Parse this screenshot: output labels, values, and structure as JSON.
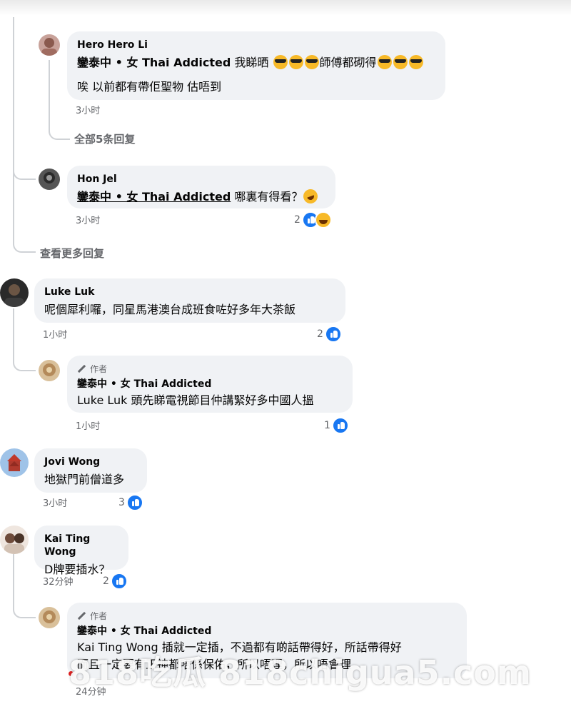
{
  "reply_hero": {
    "author": "Hero Hero Li",
    "tag": "鑾泰中 • 女 Thai Addicted",
    "text_a": "我睇晒",
    "text_b": "師傅都砌得",
    "line2": "唉 以前都有帶佢聖物 估唔到",
    "time": "3小时"
  },
  "view_replies_5": "全部5条回复",
  "reply_hon": {
    "author": "Hon Jel",
    "tag": "鑾泰中 • 女 Thai Addicted",
    "text": "哪裏有得看？",
    "time": "3小时",
    "reactions": "2"
  },
  "view_more_replies": "查看更多回复",
  "comment_luke": {
    "author": "Luke Luk",
    "text": "呢個犀利囉，同星馬港澳台成班食咗好多年大茶飯",
    "time": "1小时",
    "reactions": "2"
  },
  "reply_author_1": {
    "badge": "作者",
    "author": "鑾泰中 • 女 Thai Addicted",
    "text": "Luke Luk 頭先睇電視節目仲講緊好多中國人搵",
    "time": "1小时",
    "reactions": "1"
  },
  "comment_jovi": {
    "author": "Jovi Wong",
    "text": "地獄門前僧道多",
    "time": "3小时",
    "reactions": "3"
  },
  "comment_kai": {
    "author": "Kai Ting Wong",
    "text": "D牌要插水？",
    "time": "32分钟",
    "reactions": "2"
  },
  "reply_author_2": {
    "badge": "作者",
    "author": "鑾泰中 • 女 Thai Addicted",
    "line1": "Kai Ting Wong 插就一定插，不過都有啲話帶得好，所話帶得好",
    "line2": "而且一定要有正神都唔係保佑，所以唔理，所以唔會理",
    "time": "24分钟"
  },
  "watermark": "818吃瓜  818chigua5.com",
  "colors": {
    "bubble": "#f0f2f5",
    "like": "#1877f2",
    "meta": "#65676b"
  }
}
